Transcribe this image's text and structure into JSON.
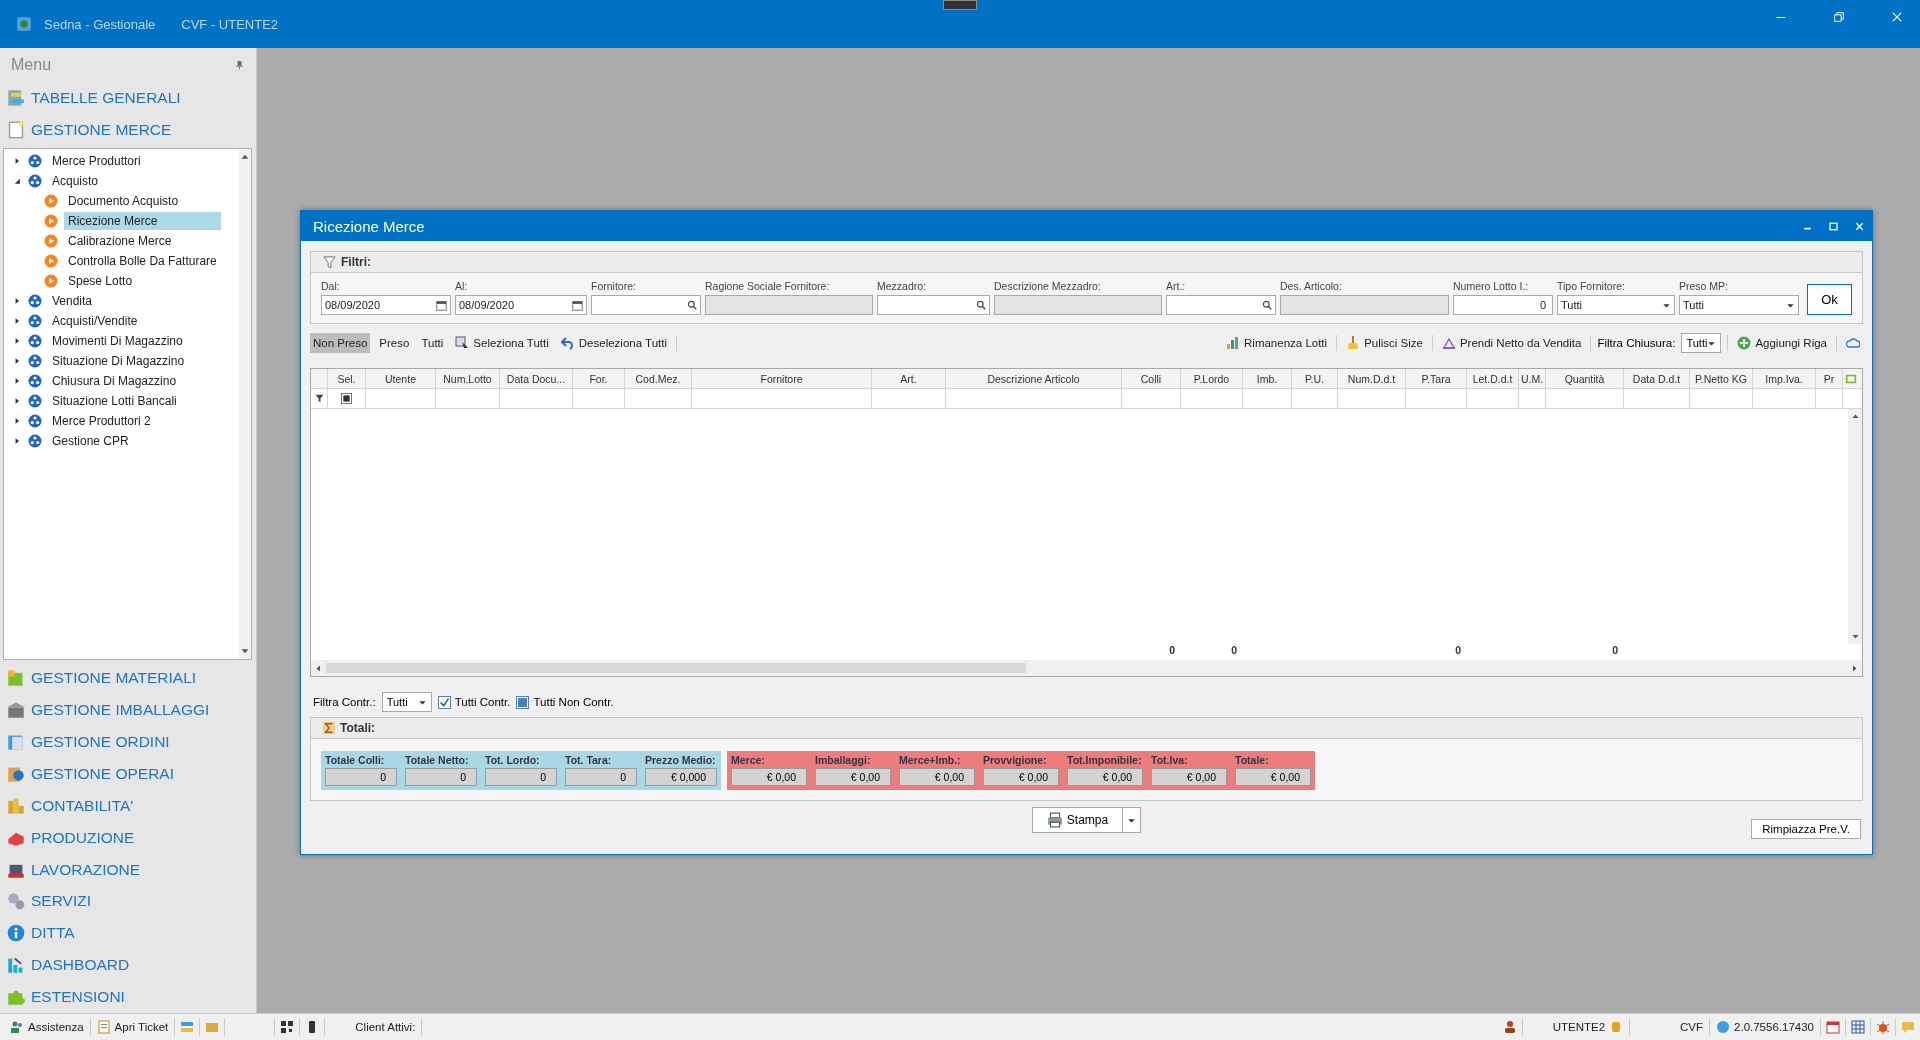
{
  "window": {
    "title": "Sedna  - Gestionale",
    "subtitle": "CVF - UTENTE2"
  },
  "sidebar": {
    "title": "Menu",
    "top_groups": [
      {
        "label": "TABELLE GENERALI"
      },
      {
        "label": "GESTIONE MERCE"
      }
    ],
    "tree": [
      {
        "label": "Merce Produttori",
        "expanded": false,
        "selected": false
      },
      {
        "label": "Acquisto",
        "expanded": true,
        "selected": false,
        "children": [
          {
            "label": "Documento Acquisto",
            "selected": false
          },
          {
            "label": "Ricezione Merce",
            "selected": true
          },
          {
            "label": "Calibrazione Merce",
            "selected": false
          },
          {
            "label": "Controlla Bolle Da Fatturare",
            "selected": false
          },
          {
            "label": "Spese Lotto",
            "selected": false
          }
        ]
      },
      {
        "label": "Vendita",
        "expanded": false,
        "selected": false
      },
      {
        "label": "Acquisti/Vendite",
        "expanded": false,
        "selected": false
      },
      {
        "label": "Movimenti Di Magazzino",
        "expanded": false,
        "selected": false
      },
      {
        "label": "Situazione Di Magazzino",
        "expanded": false,
        "selected": false
      },
      {
        "label": "Chiusura Di Magazzino",
        "expanded": false,
        "selected": false
      },
      {
        "label": "Situazione Lotti Bancali",
        "expanded": false,
        "selected": false
      },
      {
        "label": "Merce Produttori 2",
        "expanded": false,
        "selected": false
      },
      {
        "label": "Gestione CPR",
        "expanded": false,
        "selected": false
      }
    ],
    "bottom_groups": [
      {
        "label": "GESTIONE MATERIALI"
      },
      {
        "label": "GESTIONE IMBALLAGGI"
      },
      {
        "label": "GESTIONE ORDINI"
      },
      {
        "label": "GESTIONE OPERAI"
      },
      {
        "label": "CONTABILITA'"
      },
      {
        "label": "PRODUZIONE"
      },
      {
        "label": "LAVORAZIONE"
      },
      {
        "label": "SERVIZI"
      },
      {
        "label": "DITTA"
      },
      {
        "label": "DASHBOARD"
      },
      {
        "label": "ESTENSIONI"
      }
    ]
  },
  "dialog": {
    "title": "Ricezione Merce",
    "filters": {
      "title": "Filtri:",
      "ok": "Ok",
      "fields": [
        {
          "label": "Dal:",
          "kind": "date",
          "value": "08/09/2020"
        },
        {
          "label": "Al:",
          "kind": "date",
          "value": "08/09/2020"
        },
        {
          "label": "Fornitore:",
          "kind": "search"
        },
        {
          "label": "Ragione Sociale Fornitore:",
          "kind": "readonly"
        },
        {
          "label": "Mezzadro:",
          "kind": "search"
        },
        {
          "label": "Descrizione Mezzadro:",
          "kind": "readonly"
        },
        {
          "label": "Art.:",
          "kind": "search"
        },
        {
          "label": "Des. Articolo:",
          "kind": "readonly"
        },
        {
          "label": "Numero Lotto I.:",
          "kind": "number",
          "value": "0"
        },
        {
          "label": "Tipo Fornitore:",
          "kind": "select",
          "value": "Tutti"
        },
        {
          "label": "Preso MP:",
          "kind": "select",
          "value": "Tutti"
        }
      ]
    },
    "toolbar": {
      "modes": [
        {
          "label": "Non Preso",
          "selected": true
        },
        {
          "label": "Preso",
          "selected": false
        },
        {
          "label": "Tutti",
          "selected": false
        }
      ],
      "left_actions": [
        {
          "label": "Seleziona Tutti"
        },
        {
          "label": "Deseleziona Tutti"
        }
      ],
      "right_actions": [
        {
          "label": "Rimanenza Lotti"
        },
        {
          "label": "Pulisci Size"
        },
        {
          "label": "Prendi Netto da Vendita"
        }
      ],
      "chiusura": {
        "label": "Filtra Chiusura:",
        "value": "Tutti"
      },
      "add": {
        "label": "Aggiungi Riga"
      }
    },
    "grid": {
      "columns": [
        {
          "label": "Sel."
        },
        {
          "label": "Utente"
        },
        {
          "label": "Num.Lotto"
        },
        {
          "label": "Data Docu..."
        },
        {
          "label": "For."
        },
        {
          "label": "Cod.Mez."
        },
        {
          "label": "Fornitore"
        },
        {
          "label": "Art."
        },
        {
          "label": "Descrizione Articolo"
        },
        {
          "label": "Colli",
          "footer": "0"
        },
        {
          "label": "P.Lordo",
          "footer": "0"
        },
        {
          "label": "Imb."
        },
        {
          "label": "P.U."
        },
        {
          "label": "Num.D.d.t"
        },
        {
          "label": "P.Tara",
          "footer": "0"
        },
        {
          "label": "Let.D.d.t"
        },
        {
          "label": "U.M."
        },
        {
          "label": "Quantità",
          "footer": "0"
        },
        {
          "label": "Data D.d.t"
        },
        {
          "label": "P.Netto KG"
        },
        {
          "label": "Imp.Iva."
        },
        {
          "label": "Pr"
        }
      ]
    },
    "contr": {
      "label": "Filtra Contr.:",
      "value": "Tutti",
      "checks": [
        {
          "label": "Tutti Contr.",
          "checked": true,
          "partial": false
        },
        {
          "label": "Tutti Non Contr.",
          "checked": false,
          "partial": true
        }
      ]
    },
    "totals": {
      "title": "Totali:",
      "groups": [
        {
          "color": "#a8d8e6",
          "items": [
            {
              "label": "Totale Colli:",
              "value": "0"
            },
            {
              "label": "Totale Netto:",
              "value": "0"
            },
            {
              "label": "Tot. Lordo:",
              "value": "0"
            },
            {
              "label": "Tot. Tara:",
              "value": "0"
            },
            {
              "label": "Prezzo Medio:",
              "value": "€ 0,000"
            }
          ]
        },
        {
          "color": "#ee7c7c",
          "items": [
            {
              "label": "Merce:",
              "value": "€ 0,00"
            },
            {
              "label": "Imballaggi:",
              "value": "€ 0,00"
            },
            {
              "label": "Merce+Imb.:",
              "value": "€ 0,00"
            },
            {
              "label": "Provvigione:",
              "value": "€ 0,00"
            },
            {
              "label": "Tot.Imponibile:",
              "value": "€ 0,00"
            },
            {
              "label": "Tot.Iva:",
              "value": "€ 0,00"
            },
            {
              "label": "Totale:",
              "value": "€ 0,00"
            }
          ]
        }
      ]
    },
    "print": "Stampa",
    "replace": "Rimpiazza Pre.V."
  },
  "status_bar": {
    "left": [
      {
        "label": "Assistenza"
      },
      {
        "label": "Apri Ticket"
      }
    ],
    "clients": "Client Attivi:",
    "user": "UTENTE2",
    "company": "CVF",
    "version": "2.0.7556.17430"
  }
}
